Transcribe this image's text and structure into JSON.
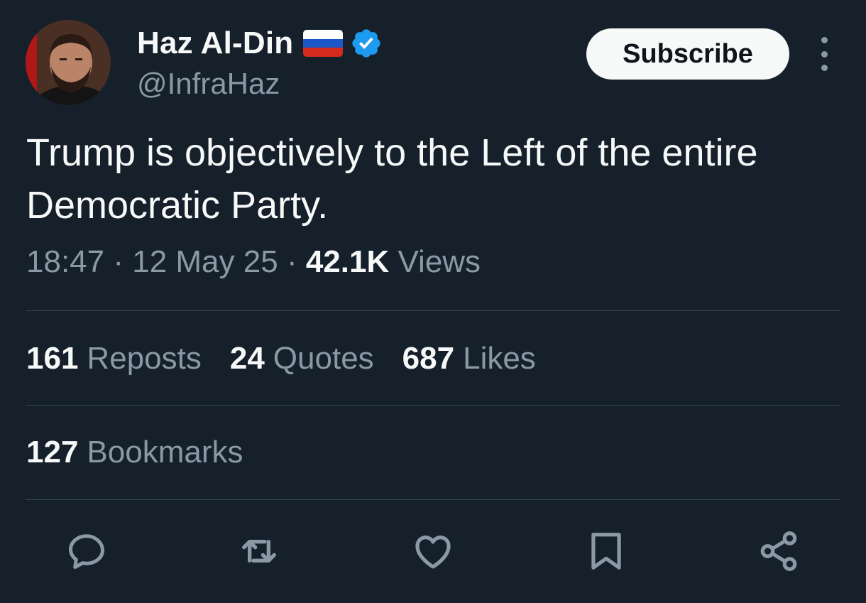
{
  "author": {
    "display_name": "Haz Al-Din",
    "handle": "@InfraHaz",
    "flag": "russia-flag",
    "verified_icon": "verified-badge-icon"
  },
  "header": {
    "subscribe_label": "Subscribe",
    "more_icon": "more-vertical-icon"
  },
  "tweet": {
    "text": "Trump is objectively to the Left of the entire Democratic Party.",
    "time": "18:47",
    "separator": "·",
    "date": "12 May 25",
    "views_count": "42.1K",
    "views_label": "Views"
  },
  "stats": {
    "reposts_count": "161",
    "reposts_label": "Reposts",
    "quotes_count": "24",
    "quotes_label": "Quotes",
    "likes_count": "687",
    "likes_label": "Likes",
    "bookmarks_count": "127",
    "bookmarks_label": "Bookmarks"
  },
  "actions": [
    "reply-icon",
    "repost-icon",
    "like-icon",
    "bookmark-icon",
    "share-icon"
  ],
  "colors": {
    "background": "#15202b",
    "text_primary": "#f7f9f9",
    "text_secondary": "#8b98a5",
    "divider": "#38444d",
    "verified_blue": "#1d9bf0"
  }
}
